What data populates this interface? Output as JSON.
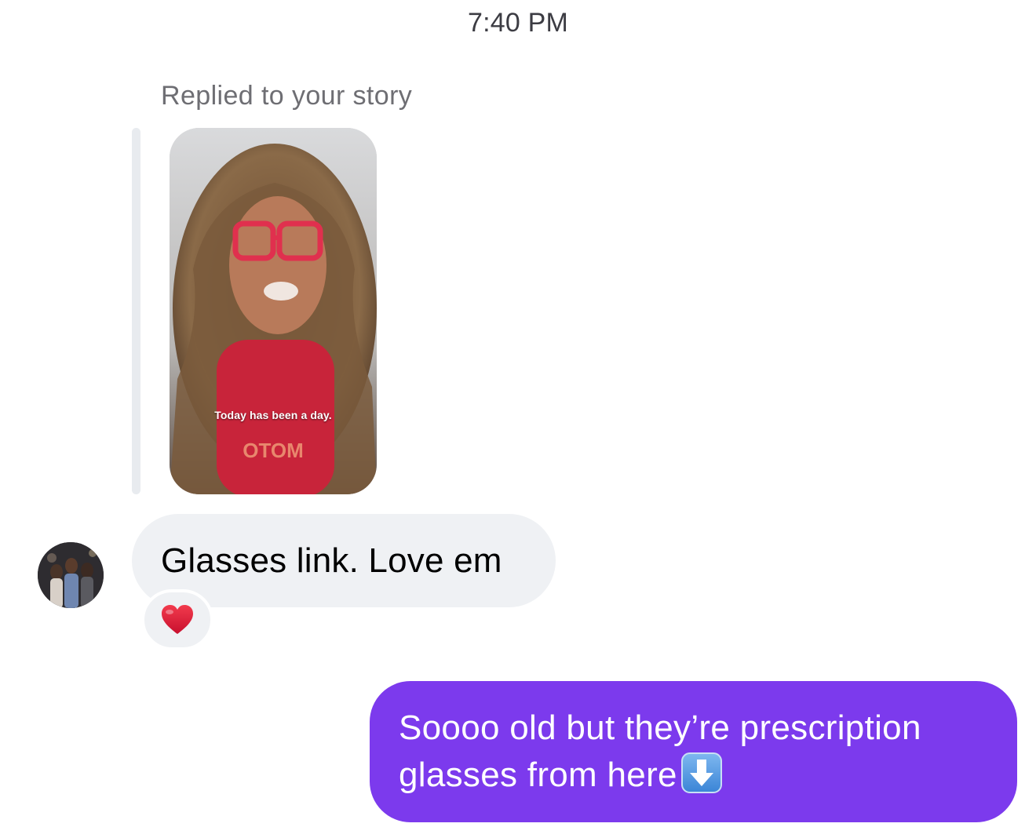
{
  "thread": {
    "timestamp": "7:40 PM",
    "story_reply": {
      "label": "Replied to your story",
      "story_caption": "Today has been a day."
    },
    "messages": [
      {
        "direction": "received",
        "text": "Glasses link. Love em",
        "reaction": "heart-emoji"
      },
      {
        "direction": "sent",
        "lines": [
          "Soooo old but they’re prescription",
          "glasses from here"
        ],
        "trailing_emoji": "down-arrow-emoji"
      }
    ]
  },
  "colors": {
    "sent_bubble": "#7c3aed",
    "received_bubble": "#eff1f4",
    "reaction_heart": "#e0182d",
    "timestamp_text": "#3c3c43",
    "label_text": "#6e6e73"
  }
}
